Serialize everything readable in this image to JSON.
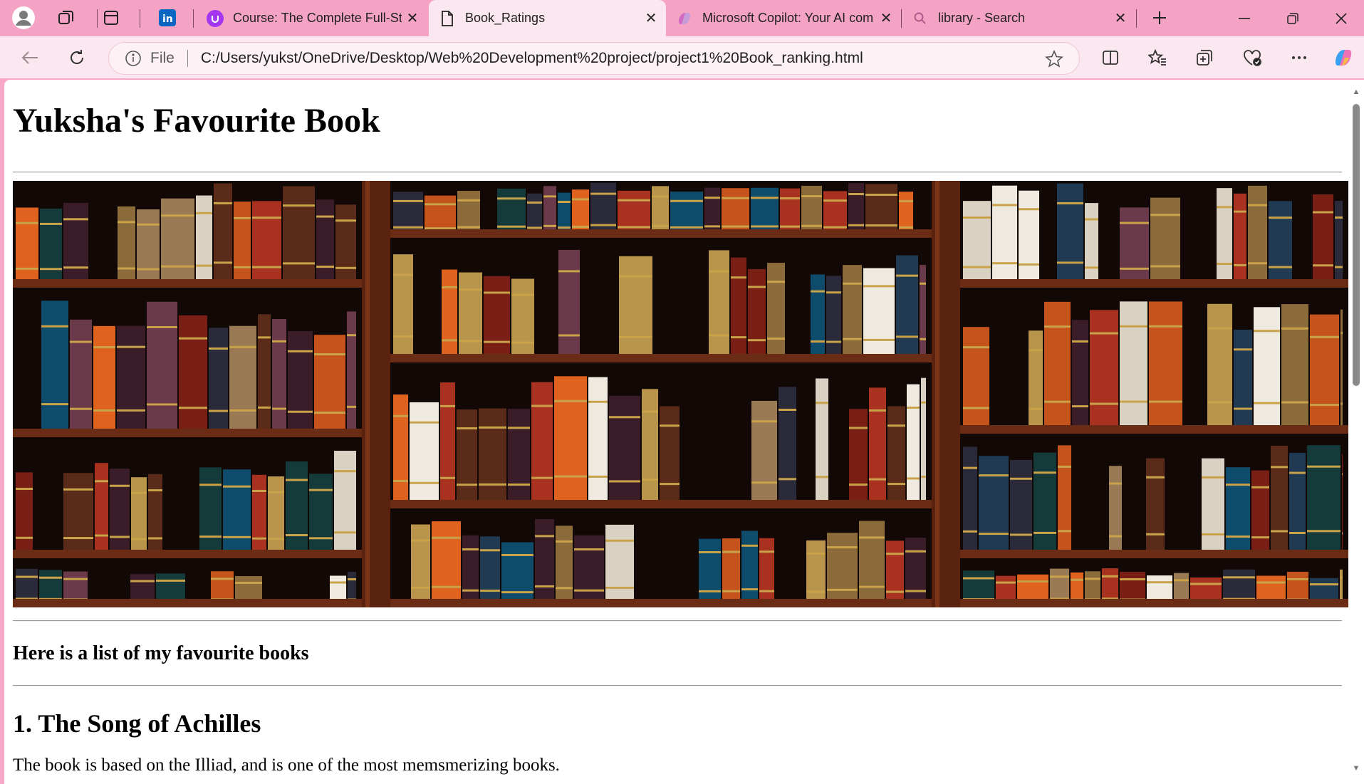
{
  "browser": {
    "tabs": [
      {
        "title": "Course: The Complete Full-Sta",
        "icon": "udemy-icon",
        "active": false
      },
      {
        "title": "Book_Ratings",
        "icon": "file-icon",
        "active": true
      },
      {
        "title": "Microsoft Copilot: Your AI com",
        "icon": "copilot-icon",
        "active": false
      },
      {
        "title": "library - Search",
        "icon": "search-icon",
        "active": false
      }
    ],
    "address": {
      "scheme_label": "File",
      "url": "C:/Users/yukst/OneDrive/Desktop/Web%20Development%20project/project1%20Book_ranking.html"
    },
    "accent": "#f5a3c4"
  },
  "page": {
    "heading": "Yuksha's Favourite Book",
    "subheading": "Here is a list of my favourite books",
    "book1_title": "1. The Song of Achilles",
    "book1_desc": "The book is based on the Illiad, and is one of the most memsmerizing books."
  }
}
